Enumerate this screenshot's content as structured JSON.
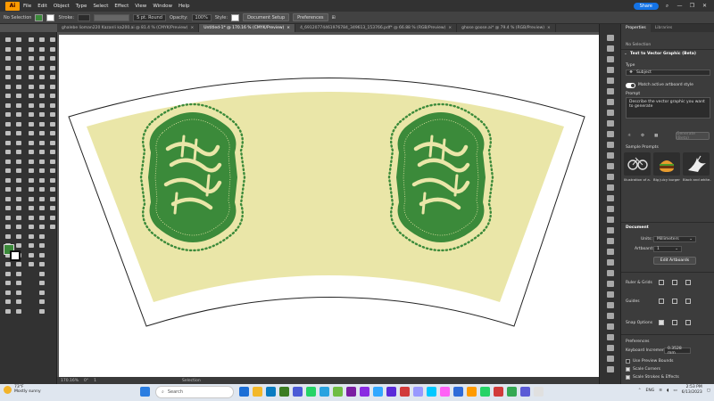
{
  "app": {
    "logo": "Ai"
  },
  "menu": [
    "File",
    "Edit",
    "Object",
    "Type",
    "Select",
    "Effect",
    "View",
    "Window",
    "Help"
  ],
  "share_label": "Share",
  "window_controls": [
    "minimize-icon",
    "restore-icon",
    "close-icon"
  ],
  "control_bar": {
    "selection": "No Selection",
    "stroke_label": "Stroke:",
    "brush": "5 pt. Round",
    "opacity_label": "Opacity:",
    "opacity_value": "100%",
    "style_label": "Style:",
    "doc_setup": "Document Setup",
    "preferences": "Preferences"
  },
  "tabs": [
    {
      "label": "ghalebe lioman220 Kazanli ka200.ai @ 81.4 % (CMYK/Preview)",
      "active": false
    },
    {
      "label": "Untitled-1* @ 170.16 % (CMYK/Preview)",
      "active": true
    },
    {
      "label": "4_69120774461976784_349613_153766.pdf* @ 66.88 % (RGB/Preview)",
      "active": false
    },
    {
      "label": "ghose goose.ai* @ 79.4 % (RGB/Preview)",
      "active": false
    }
  ],
  "colors": {
    "fill_green": "#3B8A3A",
    "cup_cream": "#EAE6A8",
    "accent": "#1473E6",
    "panel_bg": "#3c3c3c"
  },
  "status_bar": {
    "zoom": "170.16%",
    "angle": "0°",
    "artboard": "1",
    "tool": "Selection"
  },
  "properties": {
    "tabs": [
      "Properties",
      "Libraries"
    ],
    "no_selection": "No Selection",
    "feature": "Text to Vector Graphic (Beta)",
    "type_label": "Type",
    "type_value": "Subject",
    "match_style": "Match active artboard style",
    "prompt_label": "Prompt",
    "prompt_text": "Describe the vector graphic you want to generate",
    "generate": "Generate (Beta)",
    "sample_prompts_label": "Sample Prompts",
    "samples": [
      "Illustration of a...",
      "Big juicy burger...",
      "Black and white..."
    ],
    "document_label": "Document",
    "units_label": "Units:",
    "units_value": "Millimeters",
    "artboard_label": "Artboard:",
    "artboard_value": "1",
    "edit_artboards": "Edit Artboards",
    "rulers_label": "Ruler & Grids",
    "guides_label": "Guides",
    "snap_label": "Snap Options",
    "preferences_label": "Preferences",
    "keyboard_increment_label": "Keyboard Increment:",
    "keyboard_increment_value": "0.3528 mm",
    "use_preview_bounds": "Use Preview Bounds",
    "scale_corners": "Scale Corners",
    "scale_strokes": "Scale Strokes & Effects"
  },
  "taskbar": {
    "weather_temp": "73°F",
    "weather_desc": "Mostly sunny",
    "search_placeholder": "Search",
    "lang": "ENG",
    "time": "2:53 PM",
    "date": "6/13/2023"
  }
}
